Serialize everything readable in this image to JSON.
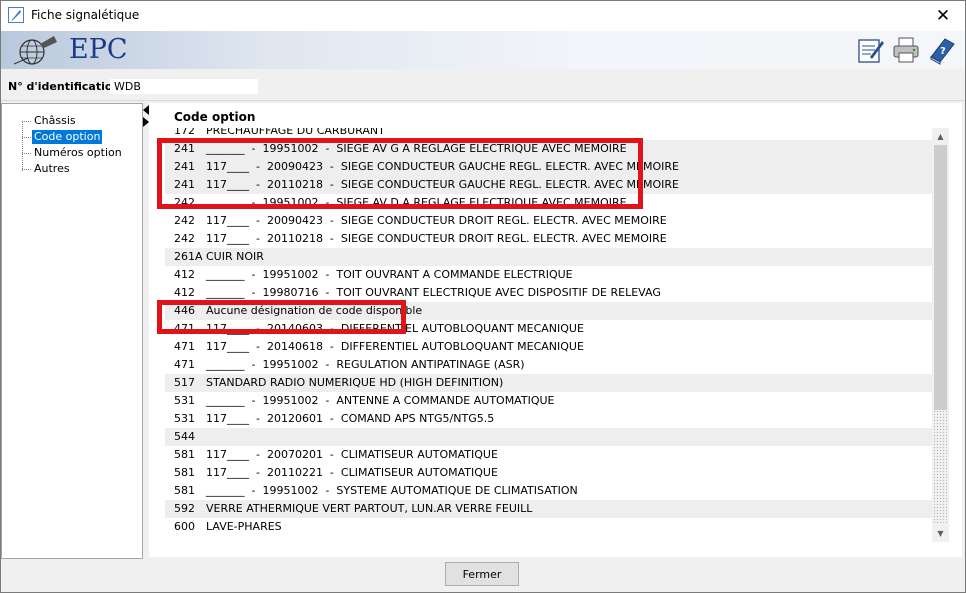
{
  "window": {
    "title": "Fiche signalétique"
  },
  "banner": {
    "brand": "EPC"
  },
  "identification": {
    "label": "N° d'identification",
    "value": "WDB"
  },
  "tree": {
    "items": [
      "Châssis",
      "Code option",
      "Numéros option",
      "Autres"
    ],
    "selected": "Code option"
  },
  "content": {
    "heading": "Code option"
  },
  "rows": [
    {
      "code": "172",
      "desc": "PRECHAUFFAGE DU CARBURANT",
      "shade": false
    },
    {
      "code": "241",
      "desc": "_______  -  19951002  -  SIEGE AV G A REGLAGE ELECTRIQUE AVEC MEMOIRE",
      "shade": true
    },
    {
      "code": "241",
      "desc": "117____  -  20090423  -  SIEGE CONDUCTEUR GAUCHE REGL. ELECTR. AVEC MEMOIRE",
      "shade": true
    },
    {
      "code": "241",
      "desc": "117____  -  20110218  -  SIEGE CONDUCTEUR GAUCHE REGL. ELECTR. AVEC MEMOIRE",
      "shade": true
    },
    {
      "code": "242",
      "desc": "_______  -  19951002  -  SIEGE AV D A REGLAGE ELECTRIQUE AVEC MEMOIRE",
      "shade": false
    },
    {
      "code": "242",
      "desc": "117____  -  20090423  -  SIEGE CONDUCTEUR DROIT REGL. ELECTR. AVEC MEMOIRE",
      "shade": false
    },
    {
      "code": "242",
      "desc": "117____  -  20110218  -  SIEGE CONDUCTEUR DROIT REGL. ELECTR. AVEC MEMOIRE",
      "shade": false
    },
    {
      "code": "261A",
      "desc": "CUIR NOIR",
      "shade": true
    },
    {
      "code": "412",
      "desc": "_______  -  19951002  -  TOIT OUVRANT A COMMANDE ELECTRIQUE",
      "shade": false
    },
    {
      "code": "412",
      "desc": "_______  -  19980716  -  TOIT OUVRANT ELECTRIQUE AVEC DISPOSITIF DE RELEVAG",
      "shade": false
    },
    {
      "code": "446",
      "desc": "Aucune désignation de code disponible",
      "shade": true
    },
    {
      "code": "471",
      "desc": "117____  -  20140603  -  DIFFERENTIEL AUTOBLOQUANT MECANIQUE",
      "shade": false
    },
    {
      "code": "471",
      "desc": "117____  -  20140618  -  DIFFERENTIEL AUTOBLOQUANT MECANIQUE",
      "shade": false
    },
    {
      "code": "471",
      "desc": "_______  -  19951002  -  REGULATION ANTIPATINAGE (ASR)",
      "shade": false
    },
    {
      "code": "517",
      "desc": "STANDARD RADIO NUMERIQUE HD (HIGH DEFINITION)",
      "shade": true
    },
    {
      "code": "531",
      "desc": "_______  -  19951002  -  ANTENNE A COMMANDE AUTOMATIQUE",
      "shade": false
    },
    {
      "code": "531",
      "desc": "117____  -  20120601  -  COMAND APS NTG5/NTG5.5",
      "shade": false
    },
    {
      "code": "544",
      "desc": "",
      "shade": true
    },
    {
      "code": "581",
      "desc": "117____  -  20070201  -  CLIMATISEUR AUTOMATIQUE",
      "shade": false
    },
    {
      "code": "581",
      "desc": "117____  -  20110221  -  CLIMATISEUR AUTOMATIQUE",
      "shade": false
    },
    {
      "code": "581",
      "desc": "_______  -  19951002  -  SYSTEME AUTOMATIQUE DE CLIMATISATION",
      "shade": false
    },
    {
      "code": "592",
      "desc": "VERRE ATHERMIQUE VERT PARTOUT, LUN.AR VERRE FEUILL",
      "shade": true
    },
    {
      "code": "600",
      "desc": "LAVE-PHARES",
      "shade": false
    }
  ],
  "footer": {
    "close_label": "Fermer"
  },
  "colors": {
    "highlight": "#e0131b",
    "selection": "#0078d7",
    "brand": "#1f3a8a"
  }
}
